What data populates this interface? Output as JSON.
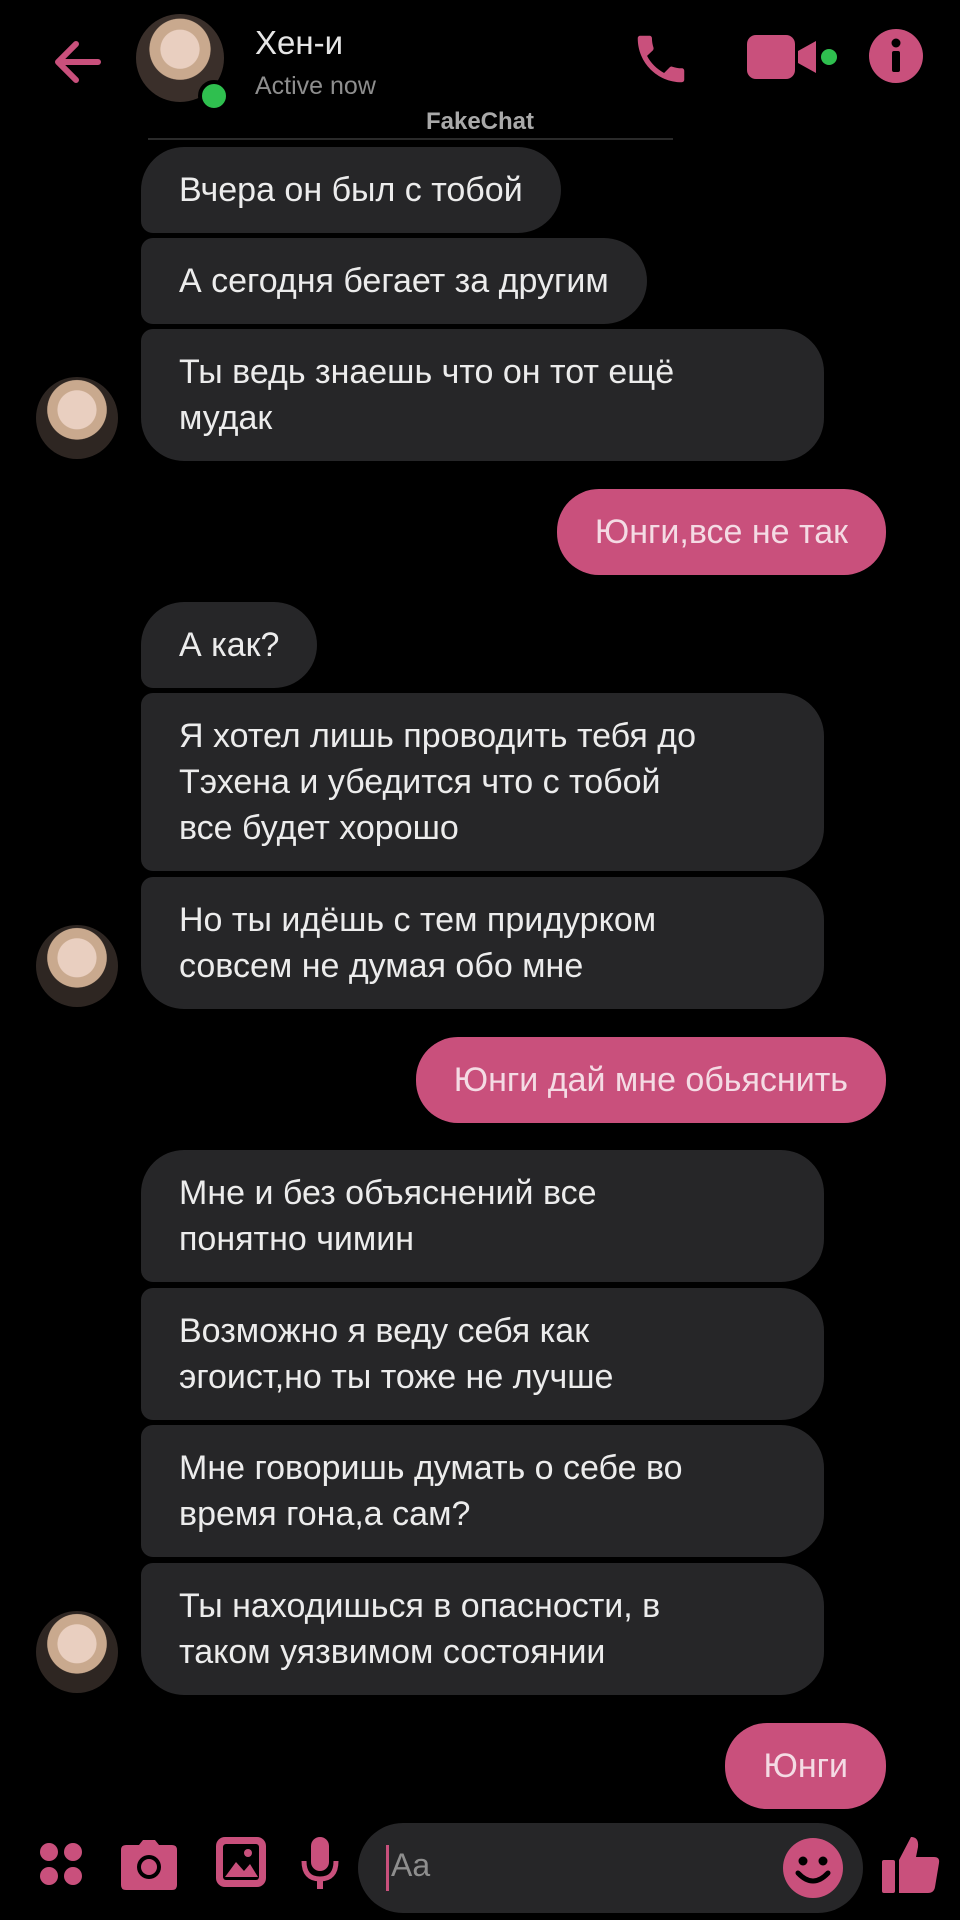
{
  "header": {
    "name": "Хен-и",
    "status": "Active now",
    "watermark": "FakeChat"
  },
  "colors": {
    "accent": "#c9507c",
    "received_bubble": "#262628",
    "background": "#000000",
    "online": "#2fbf4f"
  },
  "icons": [
    "back-arrow-icon",
    "phone-icon",
    "video-camera-icon",
    "info-icon",
    "apps-icon",
    "camera-icon",
    "gallery-icon",
    "microphone-icon",
    "emoji-icon",
    "like-icon"
  ],
  "messages": [
    {
      "side": "received",
      "text": "Вчера он был с тобой"
    },
    {
      "side": "received",
      "text": "А сегодня бегает за другим"
    },
    {
      "side": "received",
      "lines": [
        "Ты ведь знаешь что он тот ещё",
        "мудак"
      ]
    },
    {
      "side": "sent",
      "text": "Юнги,все не так"
    },
    {
      "side": "received",
      "text": "А как?"
    },
    {
      "side": "received",
      "lines": [
        "Я хотел лишь проводить тебя до",
        "Тэхена и убедится что с тобой",
        "все будет хорошо"
      ]
    },
    {
      "side": "received",
      "lines": [
        "Но ты идёшь с тем придурком",
        "совсем не думая обо мне"
      ]
    },
    {
      "side": "sent",
      "text": "Юнги дай мне обьяснить"
    },
    {
      "side": "received",
      "lines": [
        "Мне и без объяснений все",
        "понятно чимин"
      ]
    },
    {
      "side": "received",
      "lines": [
        "Возможно я веду себя как",
        "эгоист,но ты тоже не лучше"
      ]
    },
    {
      "side": "received",
      "lines": [
        "Мне говоришь думать о себе во",
        "время гона,а сам?"
      ]
    },
    {
      "side": "received",
      "lines": [
        "Ты находишься в опасности, в",
        "таком уязвимом состоянии"
      ]
    },
    {
      "side": "sent",
      "text": "Юнги"
    }
  ],
  "composer": {
    "placeholder": "Aa"
  }
}
